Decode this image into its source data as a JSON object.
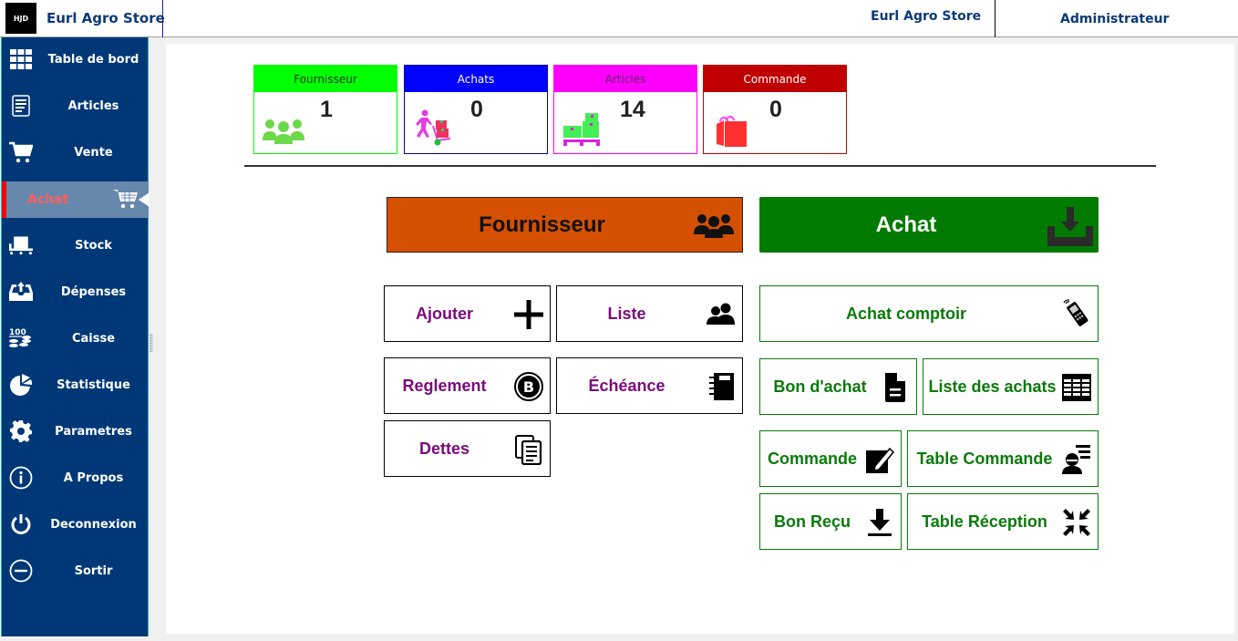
{
  "header": {
    "logo_text": "HJD",
    "app_title": "Eurl Agro Store",
    "store_name": "Eurl Agro Store",
    "user_role": "Administrateur"
  },
  "sidebar": {
    "items": [
      {
        "label": "Table de bord",
        "icon": "grid-icon"
      },
      {
        "label": "Articles",
        "icon": "document-list-icon"
      },
      {
        "label": "Vente",
        "icon": "cart-icon"
      },
      {
        "label": "Achat",
        "icon": "shopping-cart-icon",
        "active": true
      },
      {
        "label": "Stock",
        "icon": "pallet-icon"
      },
      {
        "label": "Dépenses",
        "icon": "inbox-upload-icon"
      },
      {
        "label": "Caisse",
        "icon": "coins-icon"
      },
      {
        "label": "Statistique",
        "icon": "pie-chart-icon"
      },
      {
        "label": "Parametres",
        "icon": "gear-icon"
      },
      {
        "label": "A Propos",
        "icon": "info-icon"
      },
      {
        "label": "Deconnexion",
        "icon": "power-icon"
      },
      {
        "label": "Sortir",
        "icon": "minus-circle-icon"
      }
    ]
  },
  "cards": [
    {
      "title": "Fournisseur",
      "value": "1",
      "color": "#00ff00",
      "text_color": "#333333",
      "icon": "users-icon"
    },
    {
      "title": "Achats",
      "value": "0",
      "color": "#0000ff",
      "text_color": "#ffffff",
      "icon": "delivery-person-icon"
    },
    {
      "title": "Articles",
      "value": "14",
      "color": "#ff00ff",
      "text_color": "#5a2a5a",
      "icon": "boxes-pallet-icon"
    },
    {
      "title": "Commande",
      "value": "0",
      "color": "#c00000",
      "text_color": "#ffffff",
      "icon": "shopping-bag-icon"
    }
  ],
  "sections": {
    "fournisseur": {
      "label": "Fournisseur",
      "color": "#d55000",
      "buttons": {
        "ajouter": "Ajouter",
        "liste": "Liste",
        "reglement": "Reglement",
        "echeance": "Échéance",
        "dettes": "Dettes"
      }
    },
    "achat": {
      "label": "Achat",
      "color": "#007a00",
      "buttons": {
        "achat_comptoir": "Achat comptoir",
        "bon_achat": "Bon d'achat",
        "liste_achats": "Liste des achats",
        "commande": "Commande",
        "table_commande": "Table Commande",
        "bon_recu": "Bon Reçu",
        "table_reception": "Table Réception"
      }
    }
  }
}
